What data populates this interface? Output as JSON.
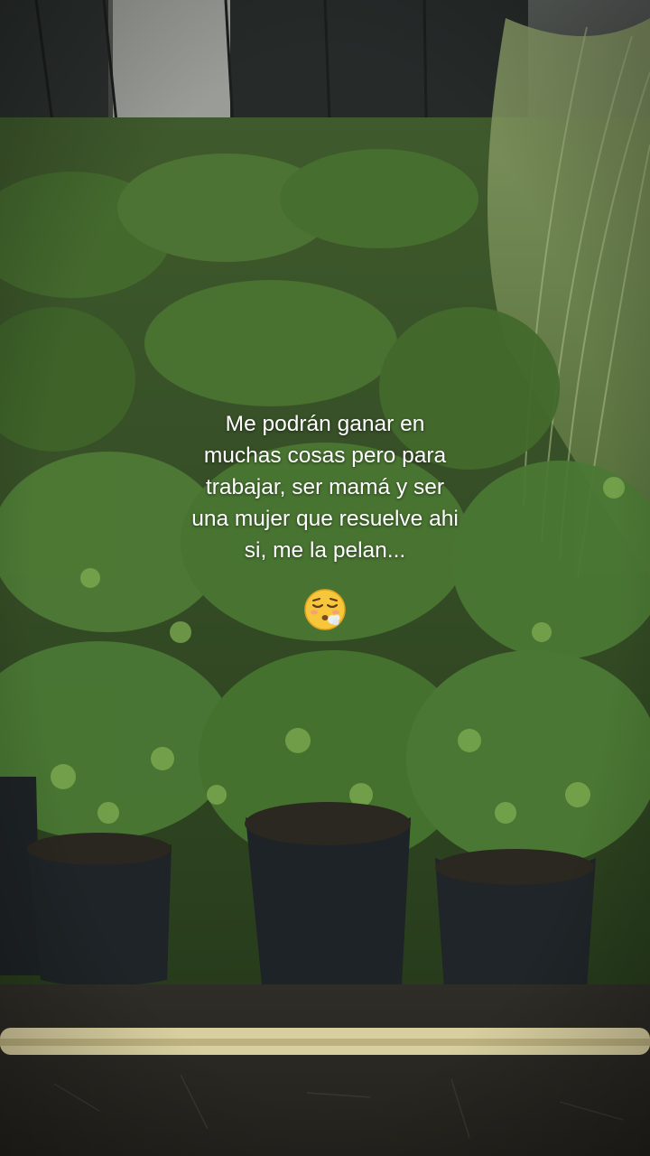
{
  "caption": {
    "lines": [
      "Me podrán ganar en",
      "muchas cosas pero para",
      "trabajar, ser mamá y ser",
      "una mujer que resuelve ahi",
      "si, me la pelan..."
    ],
    "emoji": "exhaling-face-emoji"
  },
  "scene": {
    "subject": "plant-nursery",
    "colors": {
      "foliage_dark": "#2f4a22",
      "foliage_mid": "#4f7a34",
      "foliage_light": "#8db85a",
      "pot": "#1e2326",
      "soil": "#2c2a24",
      "pipe": "#d8cfa0"
    }
  }
}
